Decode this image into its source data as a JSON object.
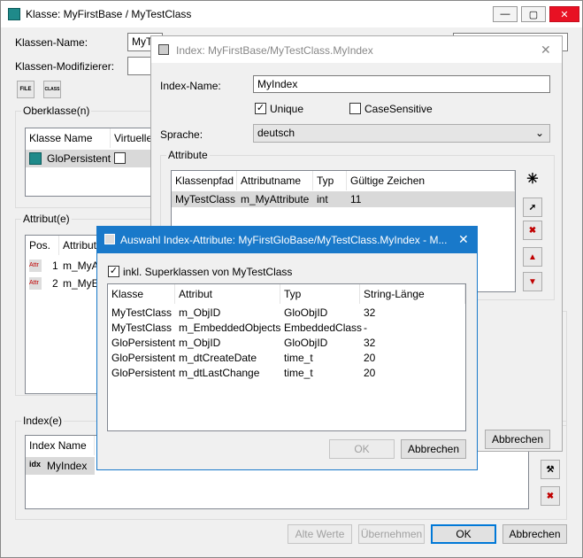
{
  "main": {
    "title": "Klasse: MyFirstBase / MyTestClass",
    "klassen_name_label": "Klassen-Name:",
    "klassen_name_value": "MyTe",
    "modifizierer_label": "Klassen-Modifizierer:",
    "file_icon_text": "FILE",
    "class_icon_text": "CLASS",
    "oberklasse_label": "Oberklasse(n)",
    "oberklasse_cols": [
      "Klasse Name",
      "Virtuelle"
    ],
    "oberklasse_row": "GloPersistent",
    "attribute_label": "Attribut(e)",
    "attribute_cols": [
      "Pos.",
      "Attribut"
    ],
    "attribute_rows": [
      {
        "pos": "1",
        "name": "m_MyAt"
      },
      {
        "pos": "2",
        "name": "m_MyE"
      }
    ],
    "attr_icon_text": "Attr",
    "index_label": "Index(e)",
    "index_col": "Index Name",
    "index_row": "MyIndex",
    "idx_icon_text": "idx",
    "btn_alte_werte": "Alte Werte",
    "btn_uebernehmen": "Übernehmen",
    "btn_ok": "OK",
    "btn_abbrechen": "Abbrechen"
  },
  "index_dialog": {
    "title": "Index: MyFirstBase/MyTestClass.MyIndex",
    "name_label": "Index-Name:",
    "name_value": "MyIndex",
    "unique_label": "Unique",
    "case_label": "CaseSensitive",
    "sprache_label": "Sprache:",
    "sprache_value": "deutsch",
    "attribute_label": "Attribute",
    "cols": [
      "Klassenpfad",
      "Attributname",
      "Typ",
      "Gültige Zeichen"
    ],
    "row": {
      "klassenpfad": "MyTestClass",
      "attributname": "m_MyAttribute",
      "typ": "int",
      "zeichen": "11"
    },
    "btn_abbrechen": "Abbrechen"
  },
  "select_dialog": {
    "title": "Auswahl Index-Attribute: MyFirstGloBase/MyTestClass.MyIndex - M...",
    "superklassen_label": "inkl. Superklassen von MyTestClass",
    "cols": [
      "Klasse",
      "Attribut",
      "Typ",
      "String-Länge"
    ],
    "rows": [
      {
        "klasse": "MyTestClass",
        "attribut": "m_ObjID",
        "typ": "GloObjID",
        "laenge": "32"
      },
      {
        "klasse": "MyTestClass",
        "attribut": "m_EmbeddedObjects",
        "typ": "EmbeddedClass",
        "laenge": "-"
      },
      {
        "klasse": "GloPersistent",
        "attribut": "m_ObjID",
        "typ": "GloObjID",
        "laenge": "32"
      },
      {
        "klasse": "GloPersistent",
        "attribut": "m_dtCreateDate",
        "typ": "time_t",
        "laenge": "20"
      },
      {
        "klasse": "GloPersistent",
        "attribut": "m_dtLastChange",
        "typ": "time_t",
        "laenge": "20"
      }
    ],
    "btn_ok": "OK",
    "btn_abbrechen": "Abbrechen"
  }
}
